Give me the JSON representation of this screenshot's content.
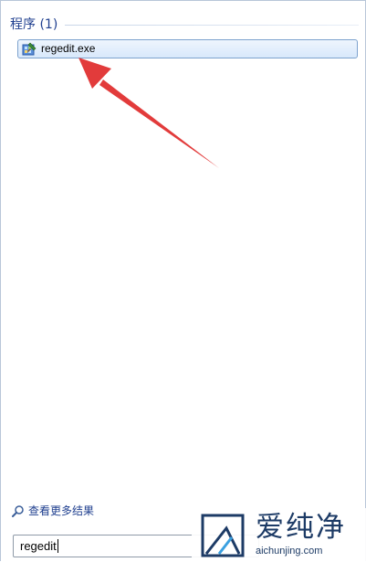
{
  "programs_section": {
    "title": "程序 (1)",
    "items": [
      {
        "label": "regedit.exe",
        "icon": "regedit-icon"
      }
    ]
  },
  "see_more": {
    "label": "查看更多结果",
    "icon": "search-icon"
  },
  "search_box": {
    "value": "regedit"
  },
  "watermark": {
    "chinese_text": "爱纯净",
    "url": "aichunjing.com"
  },
  "colors": {
    "section_title": "#1f3f8f",
    "selection_border": "#7da2ce",
    "annotation_arrow": "#e23b3b"
  }
}
